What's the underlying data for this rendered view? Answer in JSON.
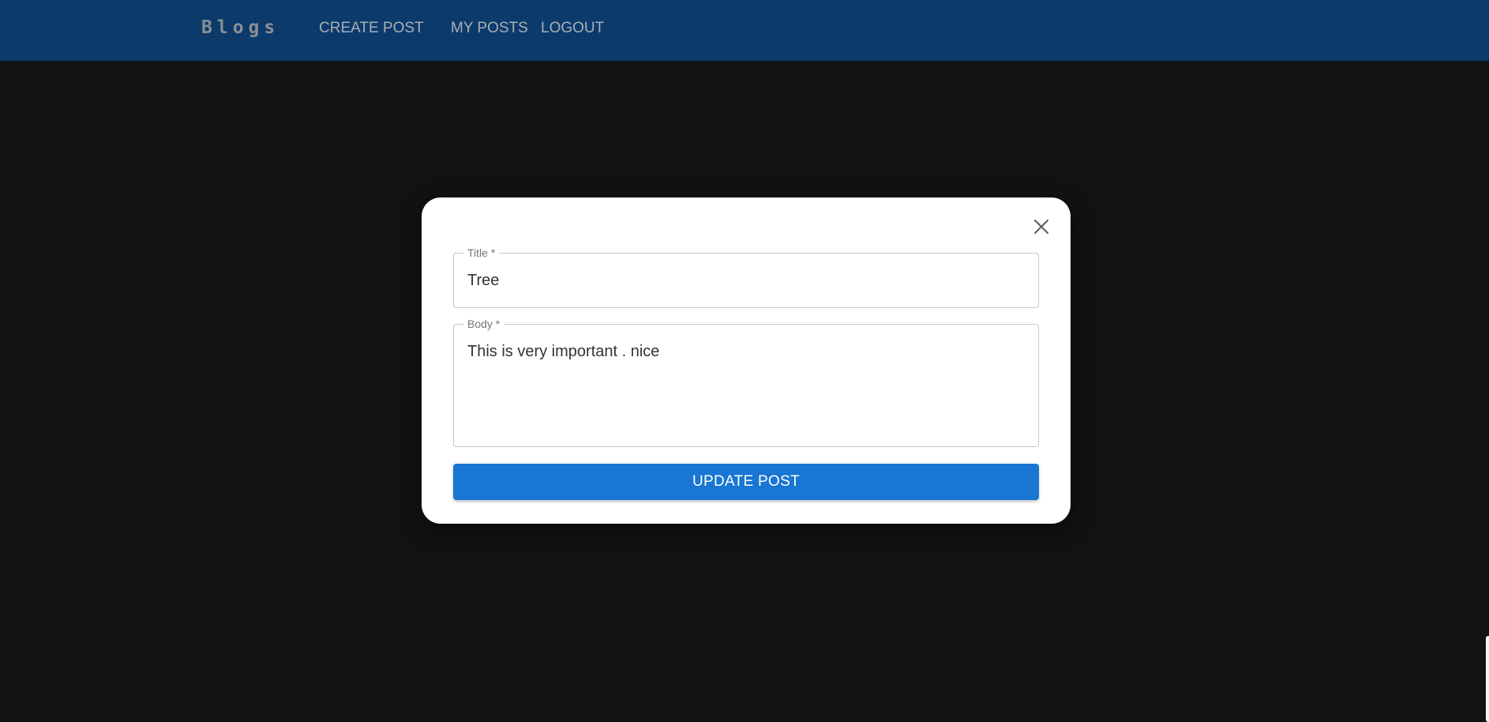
{
  "app_bar": {
    "brand": "Blogs",
    "nav": {
      "create_post": "CREATE POST",
      "my_posts": "MY POSTS",
      "logout": "LOGOUT"
    },
    "background_color": "#0c3a6b"
  },
  "modal": {
    "close_icon": "close-icon",
    "title_field": {
      "label": "Title *",
      "value": "Tree"
    },
    "body_field": {
      "label": "Body *",
      "value": "This is very important . nice"
    },
    "submit_label": "UPDATE POST",
    "accent_color": "#1976d2"
  },
  "page_background": "#121212"
}
